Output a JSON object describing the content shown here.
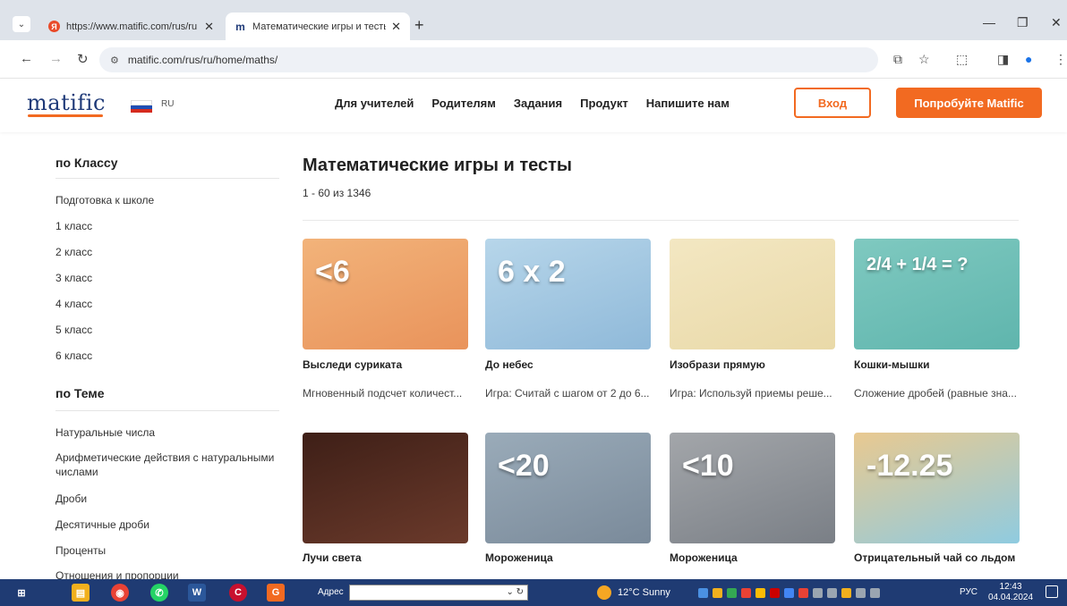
{
  "browser": {
    "tabs": [
      {
        "title": "https://www.matific.com/rus/ru",
        "favicon_color": "#e94b2a",
        "active": false
      },
      {
        "title": "Математические игры и тесты",
        "favicon_letter": "m",
        "active": true
      }
    ],
    "url": "matific.com/rus/ru/home/maths/"
  },
  "header": {
    "logo": "matific",
    "lang": "RU",
    "nav": [
      "Для учителей",
      "Родителям",
      "Задания",
      "Продукт",
      "Напишите нам"
    ],
    "login": "Вход",
    "try": "Попробуйте Matific"
  },
  "sidebar": {
    "grade_heading": "по Классу",
    "grades": [
      "Подготовка к школе",
      "1 класс",
      "2 класс",
      "3 класс",
      "4 класс",
      "5 класс",
      "6 класс"
    ],
    "topic_heading": "по Теме",
    "topics": [
      "Натуральные числа",
      "Арифметические действия с натуральными числами",
      "Дроби",
      "Десятичные дроби",
      "Проценты",
      "Отношения и пропорции"
    ]
  },
  "main": {
    "title": "Математические игры и тесты",
    "count": "1 - 60 из 1346",
    "cards": [
      {
        "title": "Выследи суриката",
        "desc": "Мгновенный подсчет количест...",
        "thumb_text": "<6",
        "colors": [
          "#e9935b",
          "#f2b37a"
        ]
      },
      {
        "title": "До небес",
        "desc": "Игра: Считай с шагом от 2 до 6...",
        "thumb_text": "6 x 2",
        "colors": [
          "#8fb9d9",
          "#b7d6ea"
        ]
      },
      {
        "title": "Изобрази прямую",
        "desc": "Игра: Используй приемы реше...",
        "thumb_text": "",
        "colors": [
          "#e9d9a8",
          "#f3e7c2"
        ]
      },
      {
        "title": "Кошки-мышки",
        "desc": "Сложение дробей (равные зна...",
        "thumb_text": "2/4 + 1/4 = ?",
        "colors": [
          "#5fb5ad",
          "#7fc9c0"
        ]
      },
      {
        "title": "Лучи света",
        "desc": "",
        "thumb_text": "",
        "colors": [
          "#6b3a2b",
          "#3e1f17"
        ]
      },
      {
        "title": "Мороженица",
        "desc": "",
        "thumb_text": "<20",
        "colors": [
          "#7a8a9a",
          "#9aabb9"
        ]
      },
      {
        "title": "Мороженица",
        "desc": "",
        "thumb_text": "<10",
        "colors": [
          "#7a7f86",
          "#a3a6aa"
        ]
      },
      {
        "title": "Отрицательный чай со льдом",
        "desc": "",
        "thumb_text": "-12.25",
        "colors": [
          "#8fcbe0",
          "#e9c990"
        ]
      }
    ]
  },
  "taskbar": {
    "address_label": "Адрес",
    "weather": "12°C Sunny",
    "lang": "РУС",
    "time": "12:43",
    "date": "04.04.2024"
  }
}
